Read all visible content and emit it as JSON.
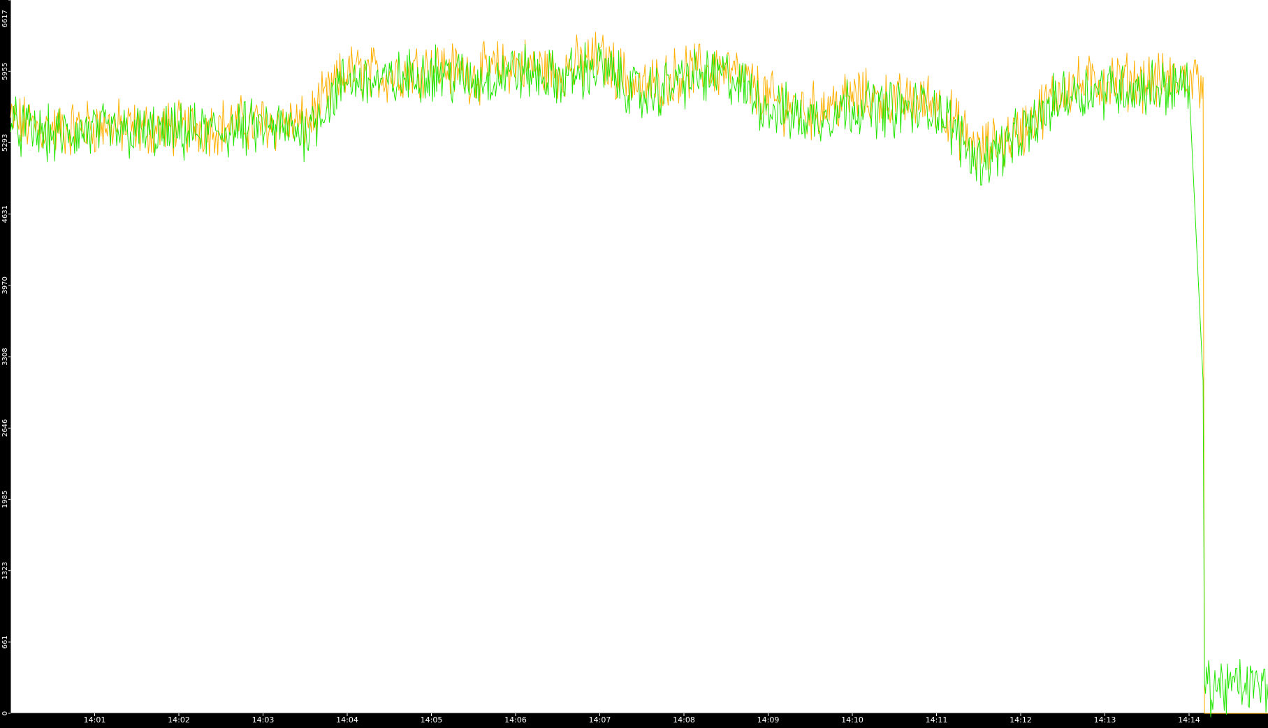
{
  "chart_data": {
    "type": "line",
    "title": "",
    "xlabel": "",
    "ylabel": "",
    "x_range_minutes": [
      14.0,
      14.28
    ],
    "ylim": [
      0,
      6617
    ],
    "y_ticks": [
      "0",
      "661",
      "1323",
      "1985",
      "2646",
      "3308",
      "3970",
      "4631",
      "5293",
      "5955",
      "6617"
    ],
    "y_tick_values": [
      0,
      661,
      1323,
      1985,
      2646,
      3308,
      3970,
      4631,
      5293,
      5955,
      6617
    ],
    "x_ticks": [
      "14:01",
      "14:02",
      "14:03",
      "14:04",
      "14:05",
      "14:06",
      "14:07",
      "14:08",
      "14:09",
      "14:10",
      "14:11",
      "14:12",
      "14:13",
      "14:14"
    ],
    "grid": false,
    "legend": "none",
    "background": "#ffffff",
    "axis_color": "#000000",
    "series": [
      {
        "color": "#ffb000",
        "x": [
          "14:00:00",
          "14:00:30",
          "14:01:00",
          "14:01:30",
          "14:02:00",
          "14:02:30",
          "14:03:00",
          "14:03:30",
          "14:04:00",
          "14:04:30",
          "14:05:00",
          "14:05:30",
          "14:06:00",
          "14:06:30",
          "14:07:00",
          "14:07:30",
          "14:08:00",
          "14:08:30",
          "14:09:00",
          "14:09:30",
          "14:10:00",
          "14:10:30",
          "14:11:00",
          "14:11:30",
          "14:12:00",
          "14:12:30",
          "14:13:00",
          "14:13:30",
          "14:14:00",
          "14:14:10",
          "14:14:11",
          "14:15:00"
        ],
        "values": [
          5500,
          5400,
          5450,
          5420,
          5430,
          5450,
          5480,
          5460,
          5950,
          5920,
          6020,
          5920,
          6020,
          5950,
          6080,
          5780,
          5950,
          5980,
          5700,
          5580,
          5720,
          5670,
          5680,
          5200,
          5400,
          5800,
          5870,
          5860,
          5880,
          5900,
          0,
          0
        ]
      },
      {
        "color": "#22e600",
        "x": [
          "14:00:00",
          "14:00:30",
          "14:01:00",
          "14:01:30",
          "14:02:00",
          "14:02:30",
          "14:03:00",
          "14:03:30",
          "14:04:00",
          "14:04:30",
          "14:05:00",
          "14:05:30",
          "14:06:00",
          "14:06:30",
          "14:07:00",
          "14:07:30",
          "14:08:00",
          "14:08:30",
          "14:09:00",
          "14:09:30",
          "14:10:00",
          "14:10:30",
          "14:11:00",
          "14:11:30",
          "14:12:00",
          "14:12:30",
          "14:13:00",
          "14:13:30",
          "14:14:00",
          "14:14:10",
          "14:14:11",
          "14:15:00"
        ],
        "values": [
          5450,
          5350,
          5400,
          5380,
          5380,
          5400,
          5430,
          5400,
          5880,
          5850,
          5960,
          5860,
          5960,
          5880,
          6000,
          5720,
          5880,
          5920,
          5620,
          5500,
          5650,
          5600,
          5620,
          5120,
          5340,
          5740,
          5800,
          5800,
          5820,
          3080,
          250,
          250
        ]
      }
    ]
  }
}
